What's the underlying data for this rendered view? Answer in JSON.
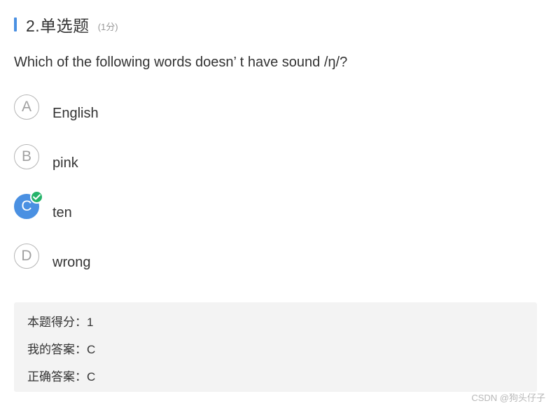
{
  "header": {
    "title": "2.单选题",
    "score": "(1分)"
  },
  "question": {
    "text": "Which of the following words doesn’ t have sound /ŋ/?"
  },
  "options": [
    {
      "letter": "A",
      "text": "English",
      "selected": false
    },
    {
      "letter": "B",
      "text": "pink",
      "selected": false
    },
    {
      "letter": "C",
      "text": "ten",
      "selected": true
    },
    {
      "letter": "D",
      "text": "wrong",
      "selected": false
    }
  ],
  "result": {
    "score_line": "本题得分：1",
    "my_answer_line": "我的答案：C",
    "correct_answer_line": "正确答案：C"
  },
  "watermark": "CSDN @狗头仔子",
  "colors": {
    "accent": "#4a90e2",
    "selected": "#4a90e2",
    "check": "#25b36a",
    "result_bg": "#f3f3f3"
  },
  "icons": {
    "selected_badge": "check-circle-icon"
  }
}
